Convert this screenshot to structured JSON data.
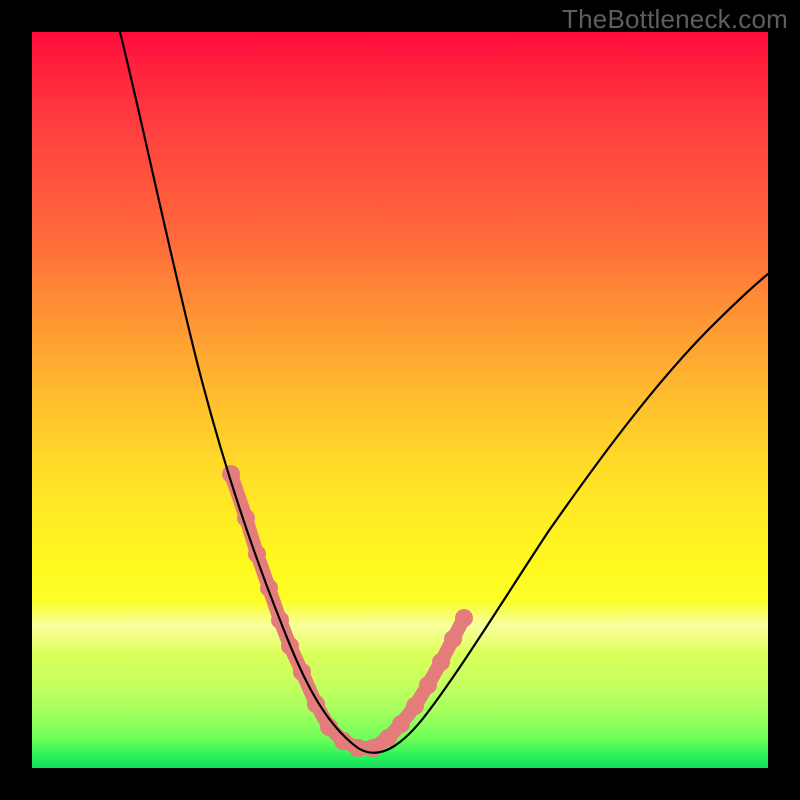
{
  "watermark": "TheBottleneck.com",
  "chart_data": {
    "type": "line",
    "title": "",
    "xlabel": "",
    "ylabel": "",
    "xlim": [
      0,
      100
    ],
    "ylim": [
      0,
      100
    ],
    "grid": false,
    "legend": false,
    "series": [
      {
        "name": "curve",
        "x": [
          12,
          14,
          16,
          18,
          20,
          22,
          24,
          26,
          28,
          30,
          31,
          32,
          33,
          34,
          35,
          36,
          37,
          38,
          40,
          42,
          45,
          48,
          52,
          56,
          60,
          65,
          70,
          76,
          82,
          88,
          94,
          100
        ],
        "y": [
          100,
          92,
          84,
          76,
          68,
          60,
          52,
          44,
          36,
          28,
          24,
          20,
          16,
          12,
          8,
          5,
          3,
          2,
          2,
          3,
          6,
          10,
          16,
          22,
          28,
          35,
          42,
          49,
          56,
          62,
          67,
          71
        ]
      }
    ],
    "highlight_segments": [
      {
        "x": [
          27,
          34.5
        ],
        "y": [
          40,
          10
        ]
      },
      {
        "x": [
          34.5,
          41.5
        ],
        "y": [
          10,
          2
        ]
      },
      {
        "x": [
          41.5,
          49
        ],
        "y": [
          2,
          12
        ]
      },
      {
        "x": [
          49,
          54
        ],
        "y": [
          12,
          20
        ]
      }
    ],
    "highlight_points": [
      {
        "x": 27,
        "y": 40
      },
      {
        "x": 29,
        "y": 32
      },
      {
        "x": 30.5,
        "y": 26
      },
      {
        "x": 32,
        "y": 19
      },
      {
        "x": 33.5,
        "y": 13
      },
      {
        "x": 35,
        "y": 8
      },
      {
        "x": 37,
        "y": 4
      },
      {
        "x": 39,
        "y": 2
      },
      {
        "x": 41,
        "y": 2
      },
      {
        "x": 43,
        "y": 4
      },
      {
        "x": 45,
        "y": 6
      },
      {
        "x": 47,
        "y": 9
      },
      {
        "x": 49,
        "y": 12
      },
      {
        "x": 51,
        "y": 16
      },
      {
        "x": 53,
        "y": 19
      },
      {
        "x": 54.5,
        "y": 22
      }
    ],
    "gradient_stops": [
      {
        "pos": 0,
        "color": "#ff0b3f"
      },
      {
        "pos": 0.28,
        "color": "#ff6a3b"
      },
      {
        "pos": 0.5,
        "color": "#ffbe2e"
      },
      {
        "pos": 0.72,
        "color": "#fff81f"
      },
      {
        "pos": 0.83,
        "color": "#e2ff55"
      },
      {
        "pos": 0.96,
        "color": "#6eff5a"
      },
      {
        "pos": 1.0,
        "color": "#12dd5e"
      }
    ]
  }
}
